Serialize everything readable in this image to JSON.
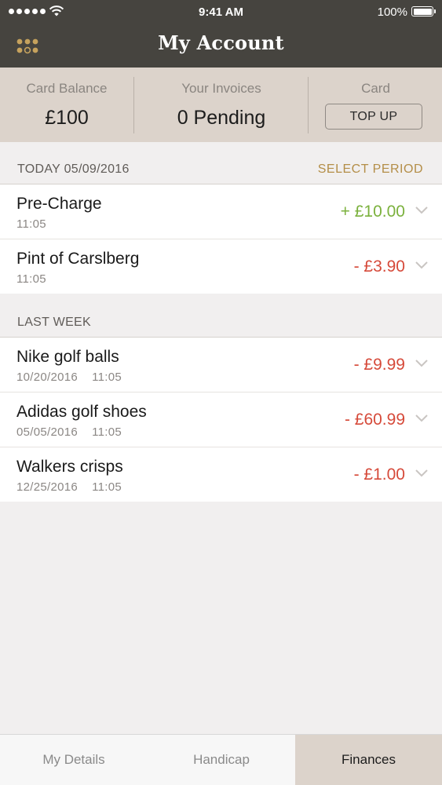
{
  "status_bar": {
    "time": "9:41 AM",
    "battery": "100%"
  },
  "header": {
    "title": "My Account",
    "menu_icon": "grid-icon"
  },
  "summary": {
    "card_balance_label": "Card Balance",
    "card_balance_value": "£100",
    "invoices_label": "Your Invoices",
    "invoices_value": "0 Pending",
    "card_label": "Card",
    "top_up_label": "TOP UP"
  },
  "sections": [
    {
      "heading": "TODAY 05/09/2016",
      "action": "SELECT PERIOD",
      "items": [
        {
          "name": "Pre-Charge",
          "date": "",
          "time": "11:05",
          "amount": "+ £10.00",
          "type": "credit"
        },
        {
          "name": "Pint of Carslberg",
          "date": "",
          "time": "11:05",
          "amount": "- £3.90",
          "type": "debit"
        }
      ]
    },
    {
      "heading": "LAST WEEK",
      "items": [
        {
          "name": "Nike golf balls",
          "date": "10/20/2016",
          "time": "11:05",
          "amount": "- £9.99",
          "type": "debit"
        },
        {
          "name": "Adidas golf shoes",
          "date": "05/05/2016",
          "time": "11:05",
          "amount": "- £60.99",
          "type": "debit"
        },
        {
          "name": "Walkers crisps",
          "date": "12/25/2016",
          "time": "11:05",
          "amount": "- £1.00",
          "type": "debit"
        }
      ]
    }
  ],
  "tabs": [
    {
      "label": "My Details",
      "active": false
    },
    {
      "label": "Handicap",
      "active": false
    },
    {
      "label": "Finances",
      "active": true
    }
  ],
  "colors": {
    "header_bg": "#46443f",
    "summary_bg": "#dcd3cb",
    "accent_gold": "#b48e48",
    "credit_green": "#7bb13d",
    "debit_red": "#d64a3a"
  }
}
